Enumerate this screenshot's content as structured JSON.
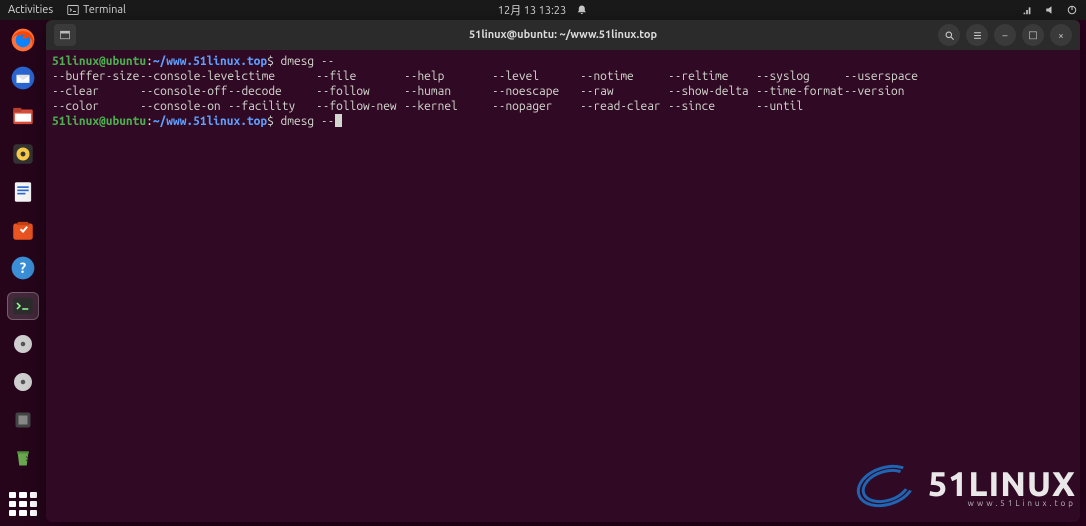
{
  "topbar": {
    "activities": "Activities",
    "app_label": "Terminal",
    "datetime": "12月 13  13:23"
  },
  "dock": {
    "items": [
      {
        "name": "firefox"
      },
      {
        "name": "thunderbird"
      },
      {
        "name": "files"
      },
      {
        "name": "rhythmbox"
      },
      {
        "name": "libreoffice-writer"
      },
      {
        "name": "software"
      },
      {
        "name": "help"
      },
      {
        "name": "terminal"
      },
      {
        "name": "disc1"
      },
      {
        "name": "disc2"
      },
      {
        "name": "tool"
      },
      {
        "name": "trash"
      }
    ]
  },
  "window": {
    "title": "51linux@ubuntu: ~/www.51linux.top"
  },
  "prompt": {
    "user_host": "51linux@ubuntu",
    "sep": ":",
    "path": "~/www.51linux.top",
    "dollar": "$",
    "cmd1": "dmesg --",
    "cmd2": "dmesg --"
  },
  "flags": [
    [
      "--buffer-size",
      "--console-level",
      "--ctime",
      "--file",
      "--help",
      "--level",
      "--notime",
      "--reltime",
      "--syslog",
      "--userspace"
    ],
    [
      "--clear",
      "--console-off",
      "--decode",
      "--follow",
      "--human",
      "--noescape",
      "--raw",
      "--show-delta",
      "--time-format",
      "--version"
    ],
    [
      "--color",
      "--console-on",
      "--facility",
      "--follow-new",
      "--kernel",
      "--nopager",
      "--read-clear",
      "--since",
      "--until",
      ""
    ]
  ],
  "watermark": {
    "brand": "51LINUX",
    "url": "www.51Linux.top"
  }
}
